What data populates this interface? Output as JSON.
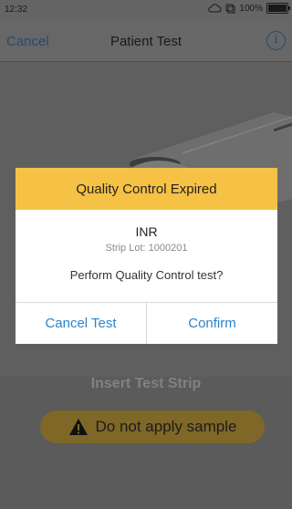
{
  "status_bar": {
    "time": "12:32",
    "battery_percent": "100%",
    "battery_level": 1.0
  },
  "nav": {
    "cancel_label": "Cancel",
    "title": "Patient Test",
    "info_icon": "info-icon"
  },
  "dialog": {
    "title": "Quality Control Expired",
    "test_name": "INR",
    "strip_lot": "Strip Lot: 1000201",
    "question": "Perform Quality Control test?",
    "cancel_label": "Cancel Test",
    "confirm_label": "Confirm"
  },
  "screen": {
    "instruction": "Insert Test Strip",
    "warning": "Do not apply sample",
    "warning_icon": "warning-triangle-icon"
  },
  "colors": {
    "dialog_header": "#f6c245",
    "dialog_button_text": "#2d83c8",
    "warning_pill": "#7f6727",
    "overlay": "#5f5f5f"
  }
}
